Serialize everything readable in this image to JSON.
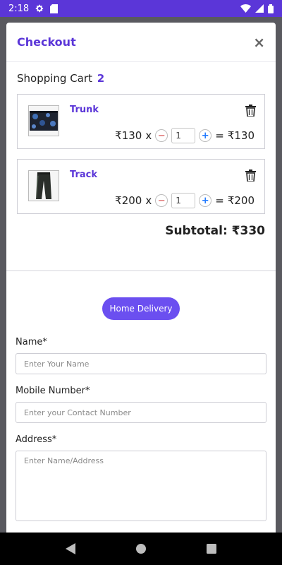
{
  "status_bar": {
    "time": "2:18",
    "icons": [
      "gear-icon",
      "sd-card-icon",
      "wifi-icon",
      "signal-icon",
      "battery-icon"
    ]
  },
  "modal": {
    "title": "Checkout",
    "close_label": "×"
  },
  "cart": {
    "heading": "Shopping Cart",
    "count": "2",
    "items": [
      {
        "name": "Trunk",
        "unit_price": "₹130",
        "times": "x",
        "qty": "1",
        "equals": "=",
        "total": "₹130",
        "thumb": "boxer-trunk-image"
      },
      {
        "name": "Track",
        "unit_price": "₹200",
        "times": "x",
        "qty": "1",
        "equals": "=",
        "total": "₹200",
        "thumb": "track-pants-image"
      }
    ],
    "minus_label": "−",
    "plus_label": "+",
    "subtotal_label": "Subtotal:",
    "subtotal_value": "₹330"
  },
  "delivery": {
    "button_label": "Home Delivery"
  },
  "form": {
    "name_label": "Name*",
    "name_placeholder": "Enter Your Name",
    "mobile_label": "Mobile Number*",
    "mobile_placeholder": "Enter your Contact Number",
    "address_label": "Address*",
    "address_placeholder": "Enter Name/Address"
  },
  "colors": {
    "accent": "#5b36d8",
    "button": "#6b4ff0",
    "plus": "#1e78ff",
    "minus": "#e07a7a"
  },
  "nav": {
    "icons": [
      "back-icon",
      "home-icon",
      "recents-icon"
    ]
  }
}
